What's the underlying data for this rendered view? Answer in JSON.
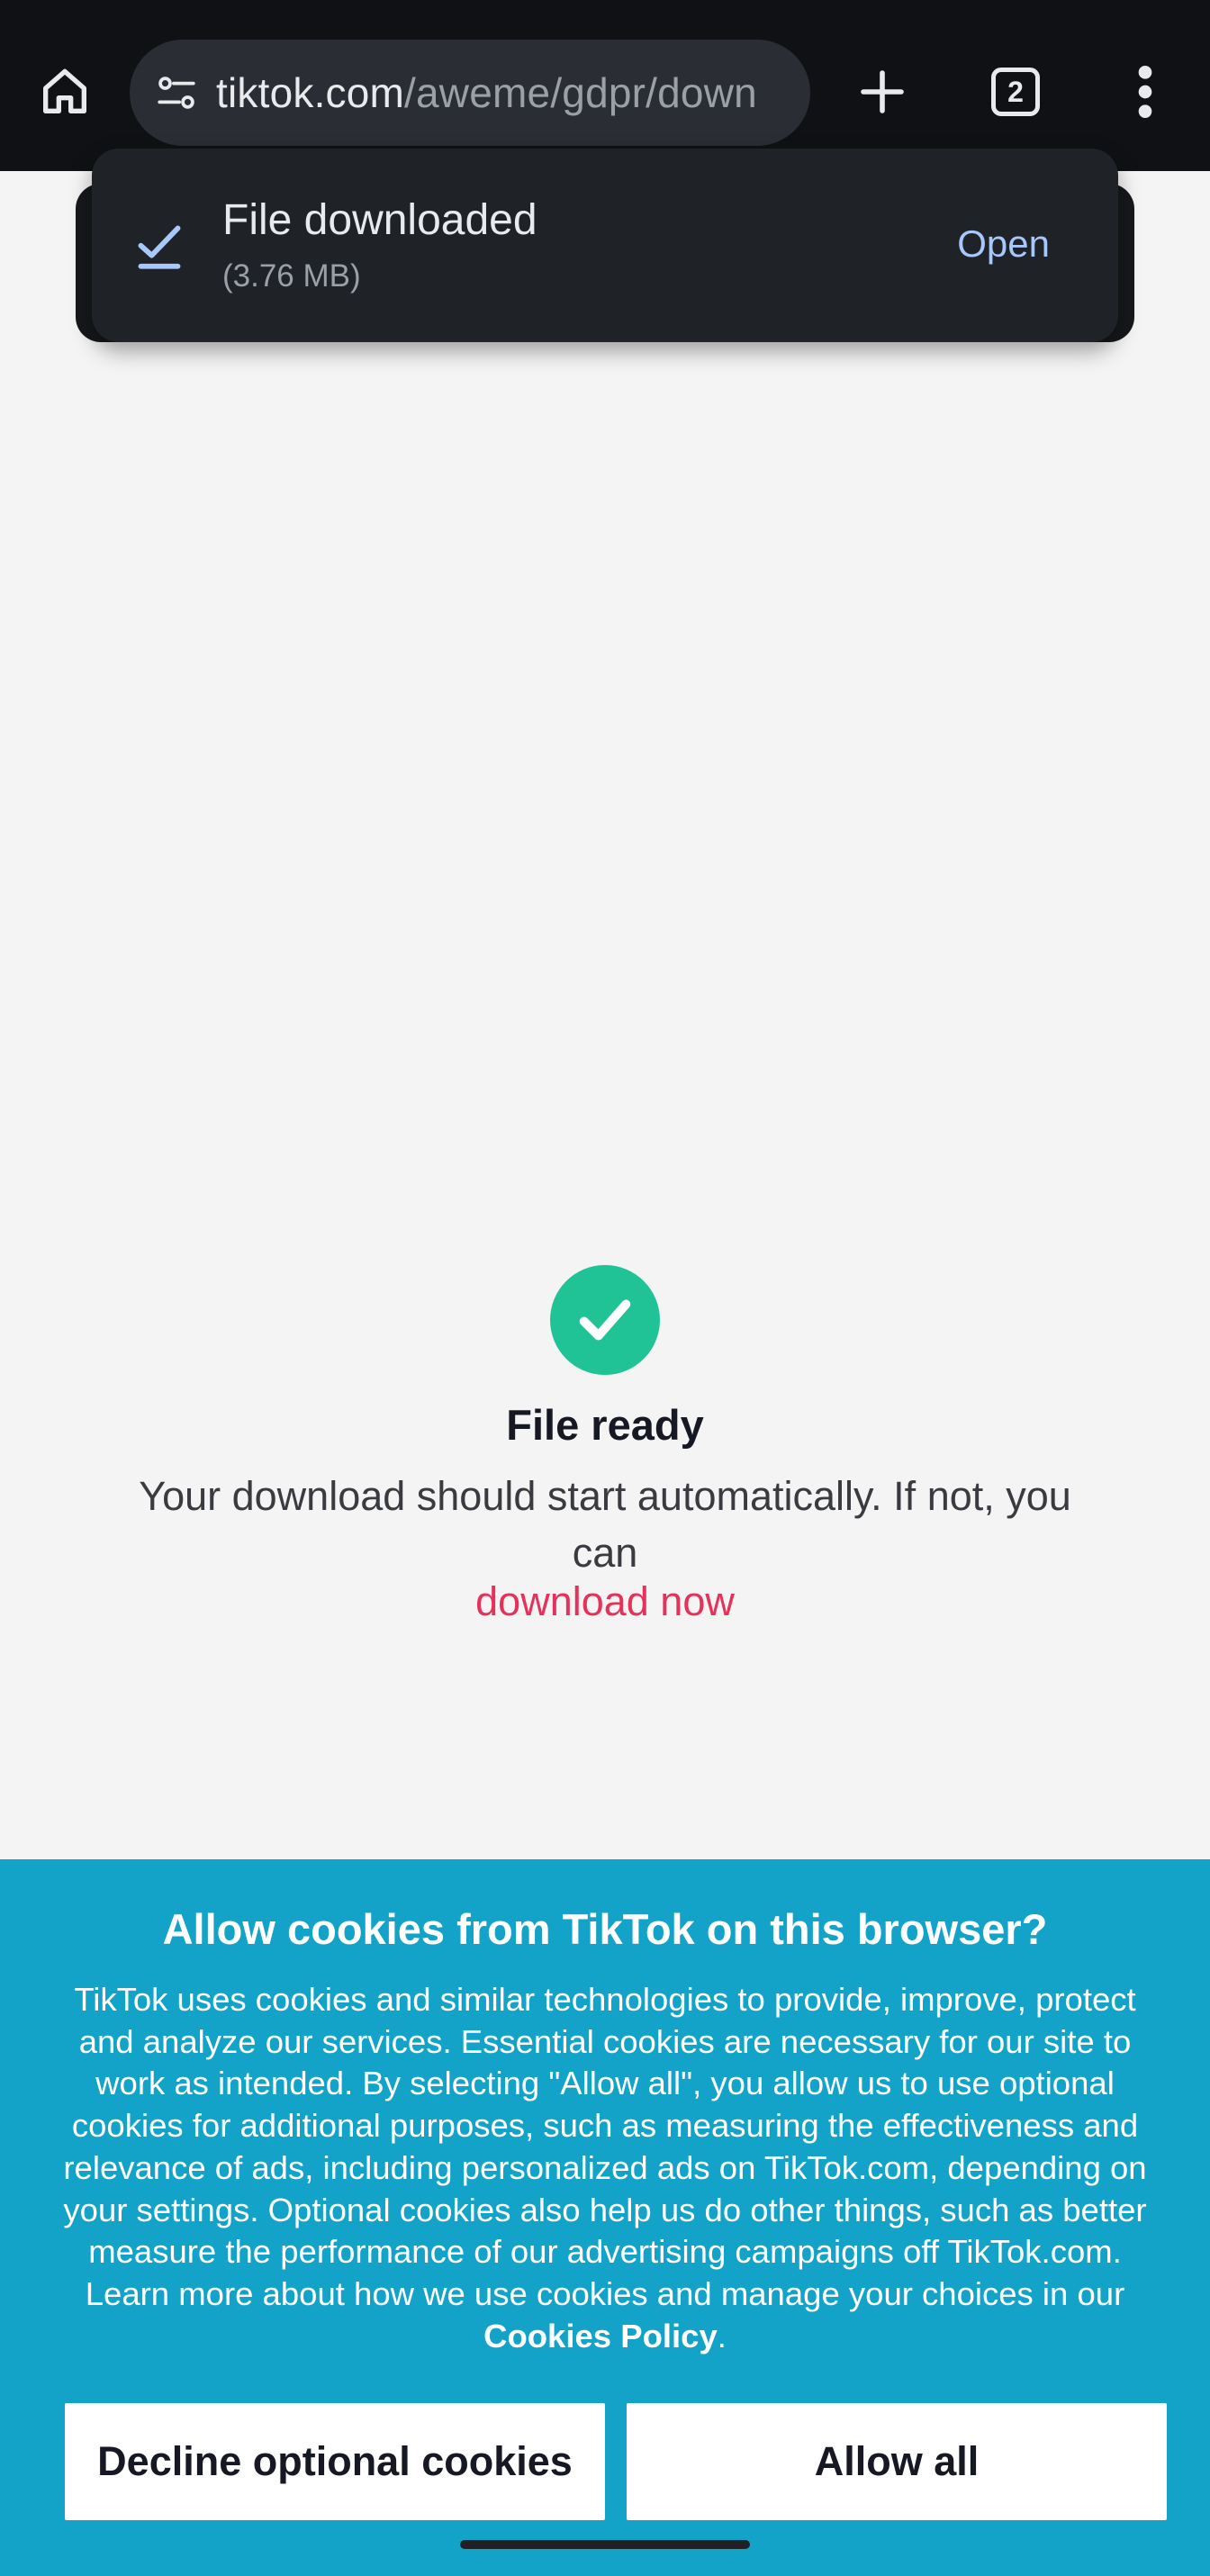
{
  "browser": {
    "url_domain": "tiktok.com",
    "url_path": "/aweme/gdpr/down",
    "tab_count": "2"
  },
  "download_snackbar": {
    "title": "File downloaded",
    "size": "(3.76 MB)",
    "action": "Open"
  },
  "main": {
    "title": "File ready",
    "description": "Your download should start automatically. If not, you can",
    "link": "download now"
  },
  "cookie_banner": {
    "title": "Allow cookies from TikTok on this browser?",
    "body": "TikTok uses cookies and similar technologies to provide, improve, protect and analyze our services. Essential cookies are necessary for our site to work as intended. By selecting \"Allow all\", you allow us to use optional cookies for additional purposes, such as measuring the effectiveness and relevance of ads, including personalized ads on TikTok.com, depending on your settings. Optional cookies also help us do other things, such as better measure the performance of our advertising campaigns off TikTok.com. Learn more about how we use cookies and manage your choices in our",
    "policy_link": "Cookies Policy",
    "policy_suffix": ".",
    "decline_button": "Decline optional cookies",
    "allow_button": "Allow all"
  },
  "colors": {
    "toolbar_bg": "#0f1114",
    "accent_check": "#20c396",
    "link_red": "#e5325a",
    "cookie_bg": "#13a2c8",
    "snackbar_action": "#a8c7fa"
  },
  "icons": [
    "home-icon",
    "site-settings-icon",
    "plus-icon",
    "tab-switcher-icon",
    "more-vert-icon",
    "download-done-icon",
    "checkmark-icon"
  ]
}
